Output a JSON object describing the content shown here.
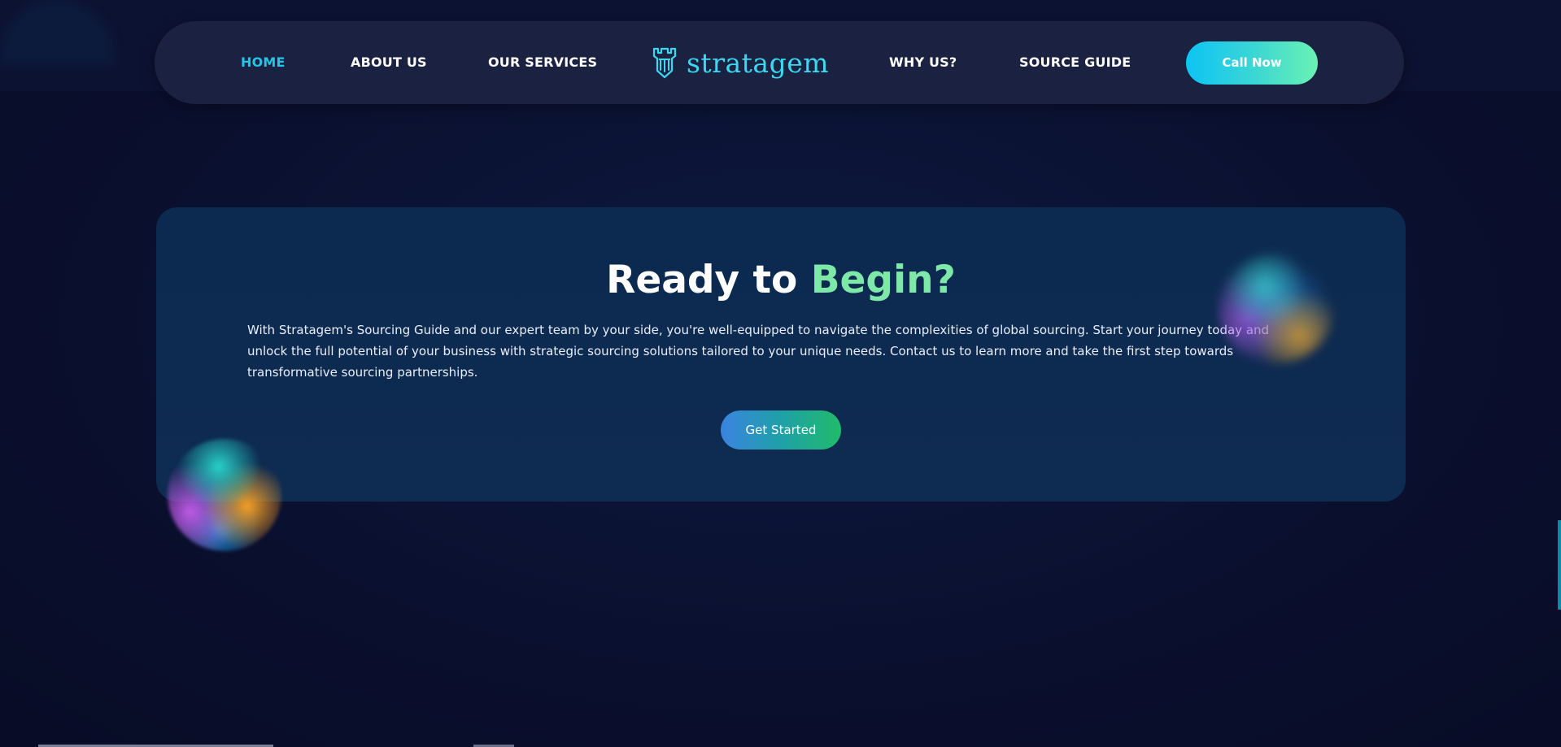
{
  "nav": {
    "items": [
      {
        "label": "HOME",
        "active": true
      },
      {
        "label": "ABOUT US",
        "active": false
      },
      {
        "label": "OUR SERVICES",
        "active": false
      },
      {
        "label": "WHY US?",
        "active": false
      },
      {
        "label": "SOURCE GUIDE",
        "active": false
      }
    ],
    "logo_text": "stratagem",
    "logo_icon": "castle-tower-icon",
    "cta_label": "Call Now"
  },
  "cta": {
    "title_prefix": "Ready to",
    "title_accent": "Begin?",
    "body": "With Stratagem's Sourcing Guide and our expert team by your side, you're well-equipped to navigate the complexities of global sourcing. Start your journey today and unlock the full potential of your business with strategic sourcing solutions tailored to your unique needs. Contact us to learn more and take the first step towards transformative sourcing partnerships.",
    "button_label": "Get Started"
  },
  "colors": {
    "background": "#0a0f2e",
    "navbar": "#1b2141",
    "active_link": "#22c6ea",
    "accent_green": "#7ee8a8",
    "card": "#0c2a4f"
  }
}
